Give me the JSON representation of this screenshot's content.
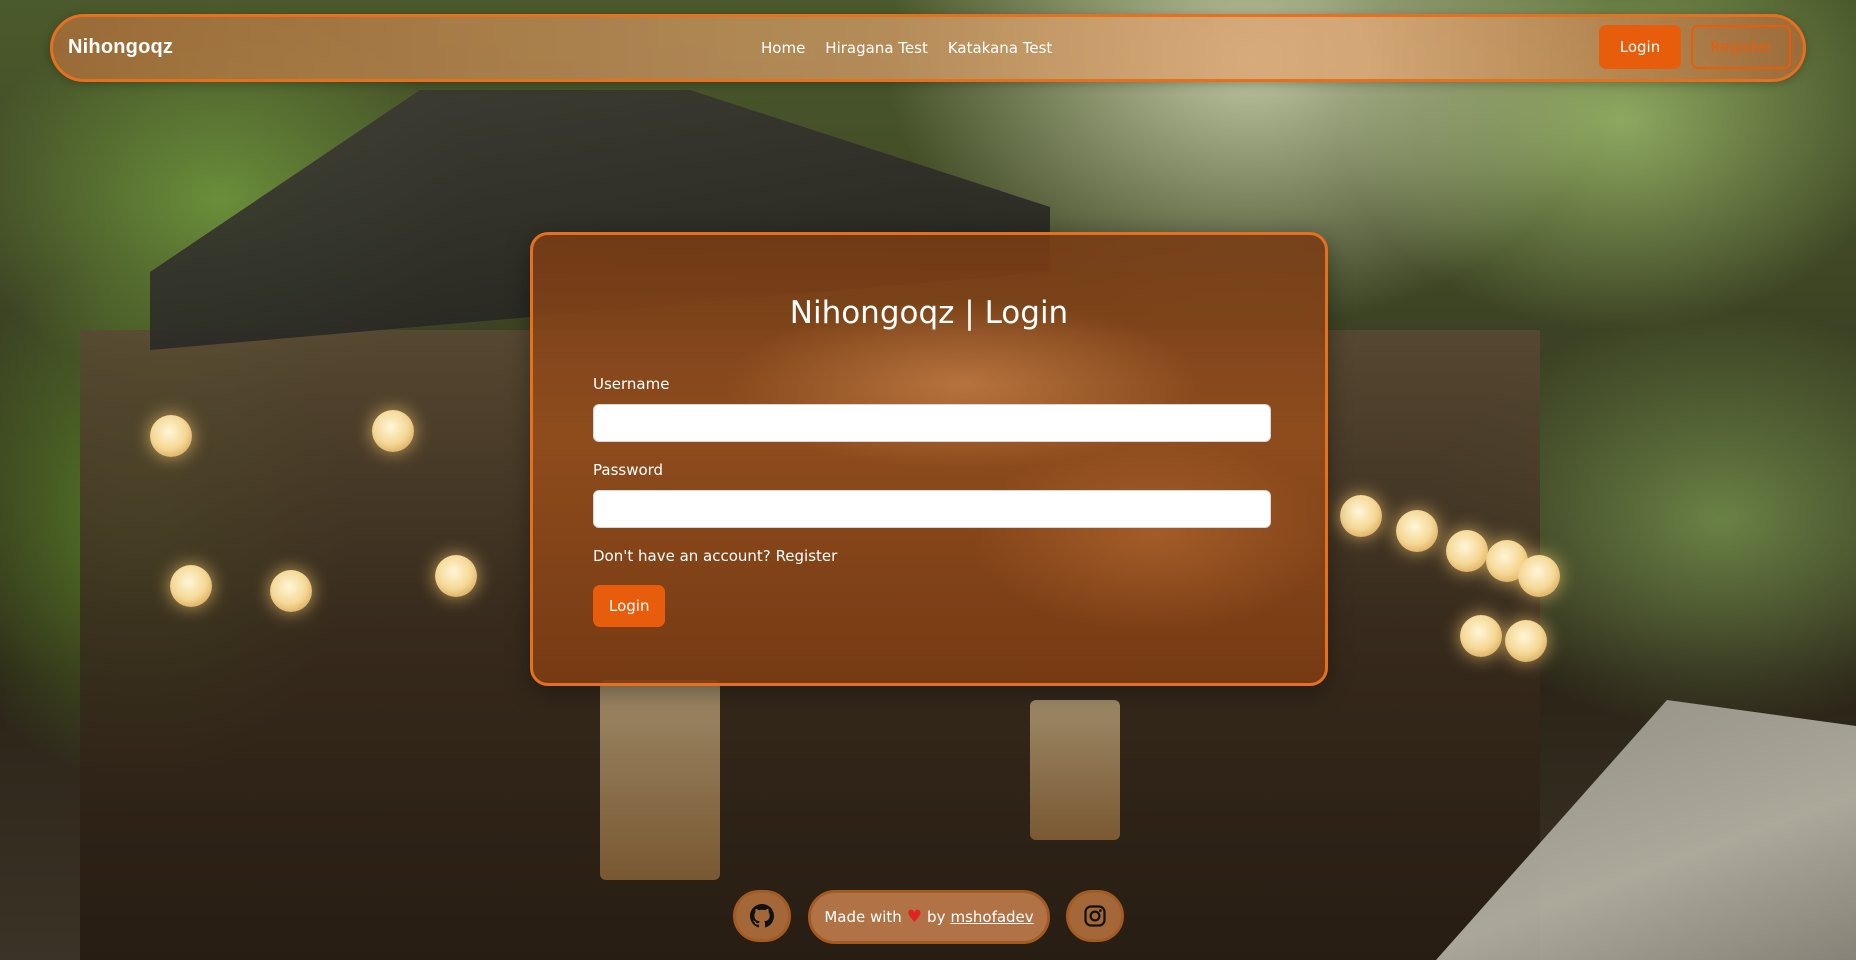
{
  "navbar": {
    "brand": "Nihongoqz",
    "links": [
      "Home",
      "Hiragana Test",
      "Katakana Test"
    ],
    "login_label": "Login",
    "register_label": "Register"
  },
  "login_card": {
    "title": "Nihongoqz | Login",
    "username_label": "Username",
    "username_value": "",
    "password_label": "Password",
    "password_value": "",
    "register_prompt": "Don't have an account?",
    "register_link": "Register",
    "submit_label": "Login"
  },
  "footer": {
    "made_with": "Made with",
    "by": "by",
    "author": "mshofadev",
    "github_icon": "github-icon",
    "instagram_icon": "instagram-icon"
  },
  "colors": {
    "accent": "#e85d0c",
    "border": "#e5701f"
  }
}
